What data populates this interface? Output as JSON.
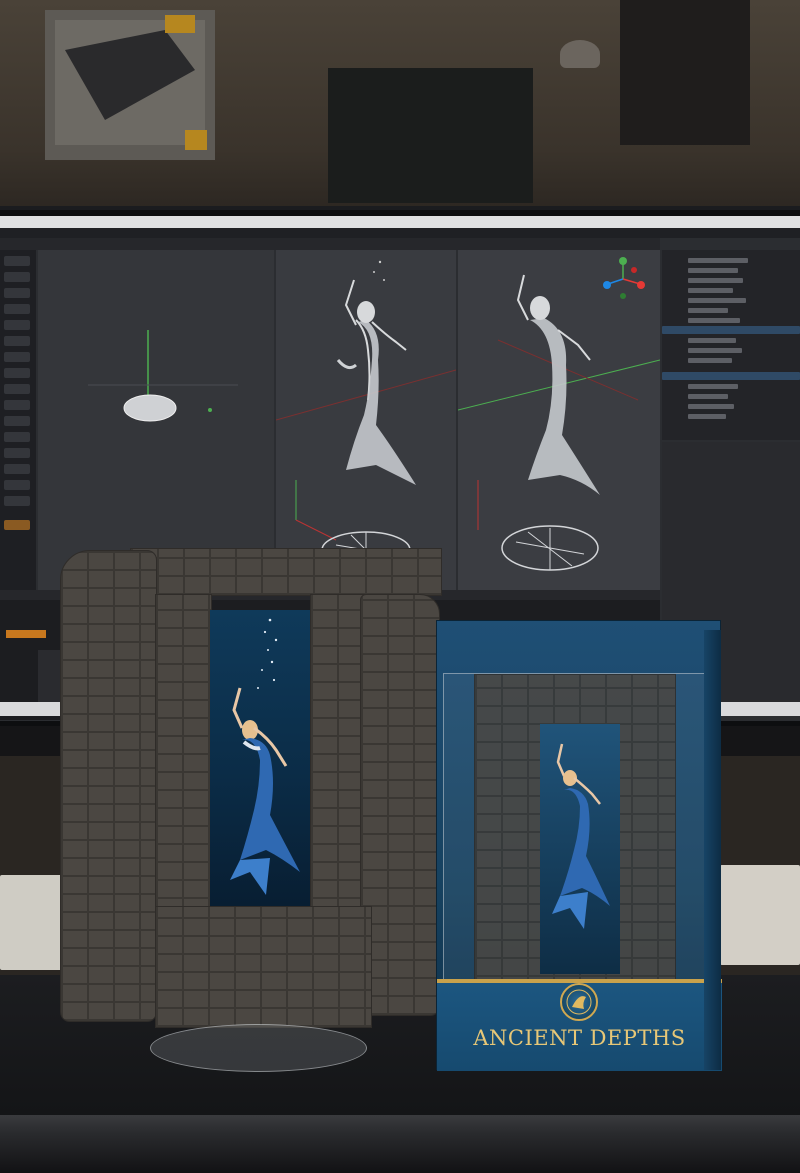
{
  "scene": {
    "description_colors": {
      "stone": "#4b4742",
      "water_blue": "#0f3a5a",
      "box_blue": "#1f4f75",
      "gold": "#e7c777",
      "screen_dark": "#2b2d31"
    }
  },
  "product_box": {
    "title": "ANCIENT DEPTHS",
    "subtitle": "",
    "emblem_icon": "mermaid-emblem-icon"
  },
  "monitor": {
    "app": "3d-modeling-software",
    "view_gizmo_icon": "axis-gizmo-icon"
  }
}
